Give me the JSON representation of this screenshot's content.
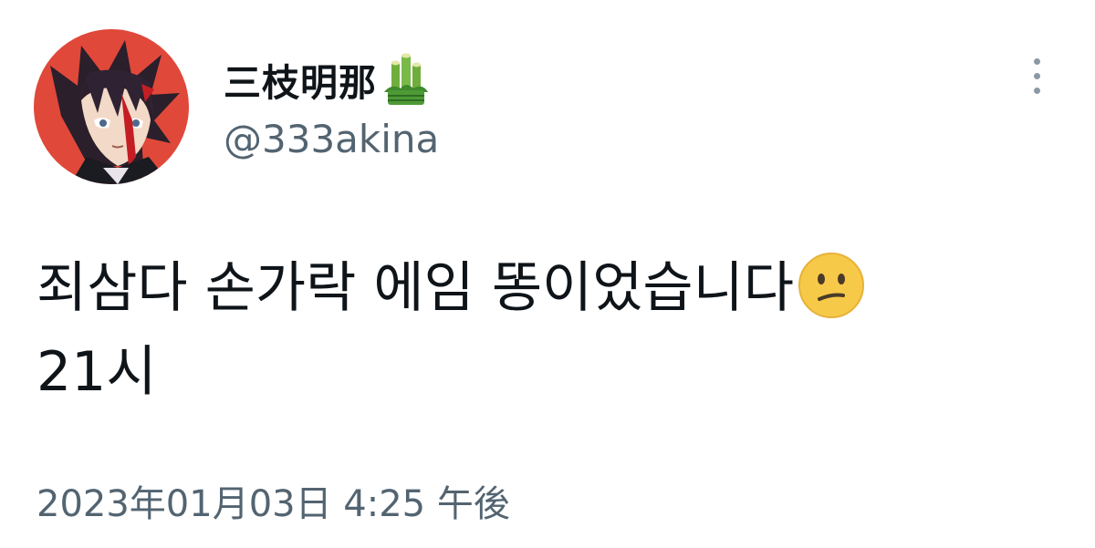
{
  "user": {
    "display_name": "三枝明那",
    "name_emoji": "kadomatsu-icon",
    "handle": "@333akina",
    "avatar": "anime-character-avatar"
  },
  "menu": {
    "icon": "more-options-vertical-icon"
  },
  "tweet": {
    "line1": "죄삼다 손가락 에임 똥이었습니다",
    "line1_emoji": "confused-face-emoji",
    "line2": "21시"
  },
  "timestamp": "2023年01月03日 4:25 午後",
  "colors": {
    "text_primary": "#0f1419",
    "text_secondary": "#536471",
    "avatar_bg": "#e0483a",
    "emoji_yellow": "#f7c948"
  }
}
